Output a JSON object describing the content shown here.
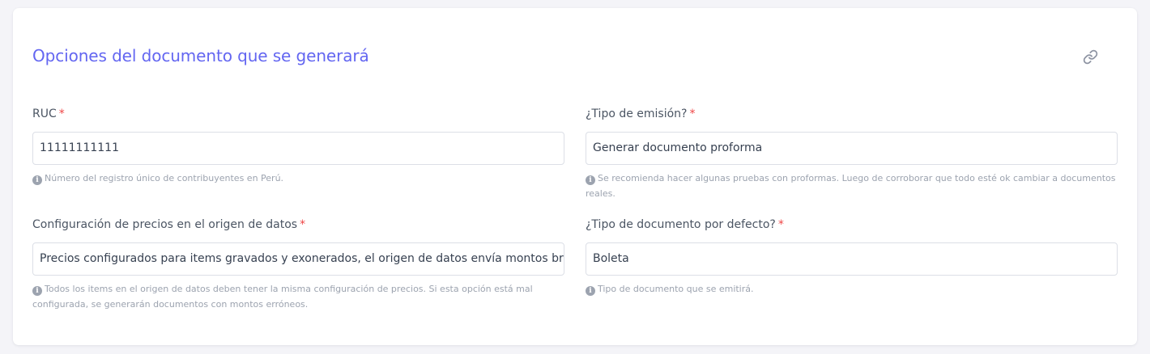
{
  "card": {
    "title": "Opciones del documento que se generará",
    "link_icon": "link-icon",
    "accent_color": "#6366f1"
  },
  "fields": {
    "ruc": {
      "label": "RUC",
      "required_mark": "*",
      "value": "11111111111",
      "help_icon": "info-icon",
      "help": "Número del registro único de contribuyentes en Perú."
    },
    "emission_type": {
      "label": "¿Tipo de emisión?",
      "required_mark": "*",
      "value": "Generar documento proforma",
      "help_icon": "info-icon",
      "help": "Se recomienda hacer algunas pruebas con proformas. Luego de corroborar que todo esté ok cambiar a documentos reales."
    },
    "price_config": {
      "label": "Configuración de precios en el origen de datos",
      "required_mark": "*",
      "value": "Precios configurados para items gravados y exonerados, el origen de datos envía montos brutos",
      "help_icon": "info-icon",
      "help": "Todos los items en el origen de datos deben tener la misma configuración de precios. Si esta opción está mal configurada, se generarán documentos con montos erróneos."
    },
    "default_doc_type": {
      "label": "¿Tipo de documento por defecto?",
      "required_mark": "*",
      "value": "Boleta",
      "help_icon": "info-icon",
      "help": "Tipo de documento que se emitirá."
    }
  }
}
